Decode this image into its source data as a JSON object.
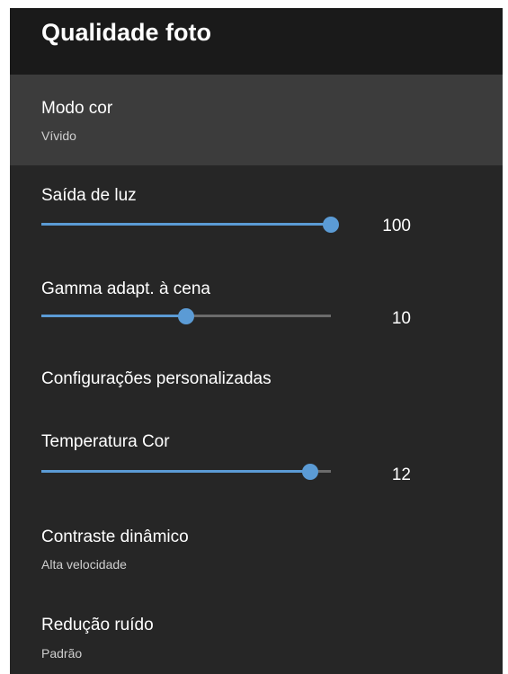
{
  "header": {
    "title": "Qualidade foto"
  },
  "color_mode": {
    "label": "Modo cor",
    "value": "Vívido"
  },
  "light_output": {
    "label": "Saída de luz",
    "value": "100",
    "fraction": 1.0
  },
  "gamma": {
    "label": "Gamma adapt. à cena",
    "value": "10",
    "fraction": 0.5
  },
  "custom_settings": {
    "label": "Configurações personalizadas"
  },
  "color_temperature": {
    "label": "Temperatura Cor",
    "value": "12",
    "fraction": 0.93
  },
  "dynamic_contrast": {
    "label": "Contraste dinâmico",
    "value": "Alta velocidade"
  },
  "noise_reduction": {
    "label": "Redução ruído",
    "value": "Padrão"
  },
  "colors": {
    "accent": "#5b9bd5",
    "background": "#262626",
    "header": "#1a1a1a",
    "selected": "#3c3c3c"
  }
}
